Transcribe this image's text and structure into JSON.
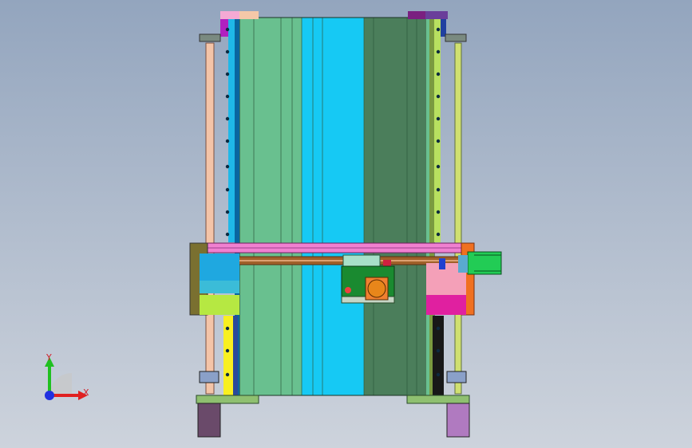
{
  "viewport": {
    "background_top": "#93a5be",
    "background_bottom": "#cdd3dc"
  },
  "triad": {
    "x_label": "X",
    "y_label": "Y",
    "x_color": "#e02020",
    "y_color": "#20c020",
    "origin_color": "#2030e0"
  },
  "model": {
    "name_icon": "linear-module-assembly-icon",
    "colors": {
      "panel_light_green": "#69c08f",
      "panel_cyan": "#16c9f4",
      "panel_dark_green": "#4b7e5b",
      "rail_cyan": "#1fb8e8",
      "rail_yellow_green": "#b8e060",
      "carriage_pink": "#f080d0",
      "screw_brown": "#a0602a",
      "motor_green": "#22cc55",
      "motor_body": "#6a4a6a",
      "bracket_orange": "#f07020",
      "block_magenta": "#e020a0",
      "block_yellow": "#f0f020"
    }
  }
}
